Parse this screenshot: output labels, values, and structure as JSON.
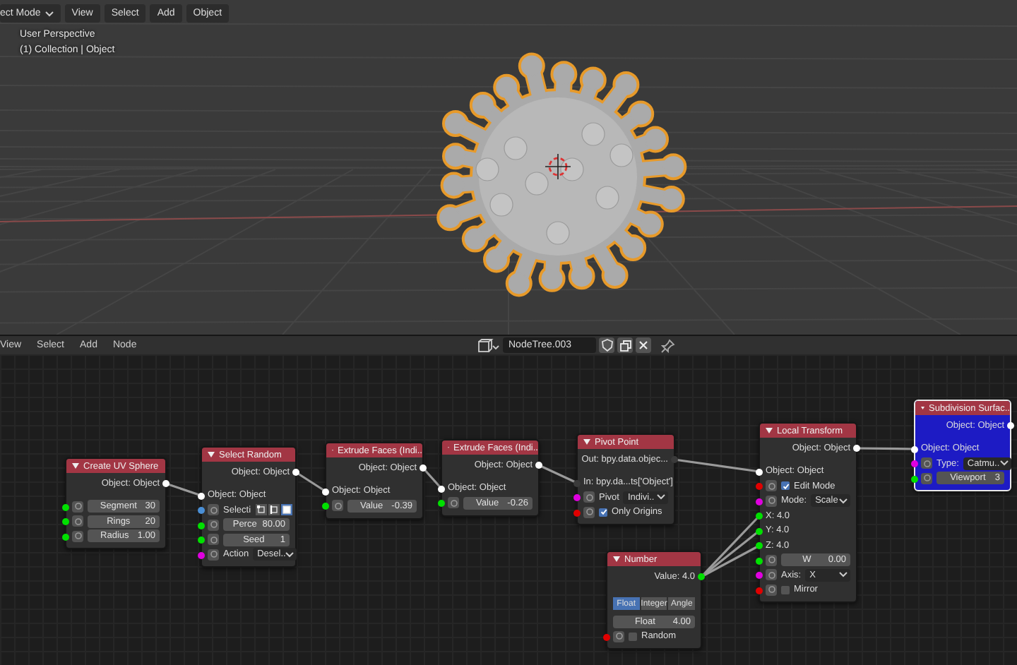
{
  "viewport": {
    "mode_menu": "ect Mode",
    "menus": [
      "View",
      "Select",
      "Add",
      "Object"
    ],
    "overlay": [
      "User Perspective",
      "(1) Collection | Object"
    ]
  },
  "node_editor": {
    "menus": [
      "View",
      "Select",
      "Add",
      "Node"
    ],
    "tree_name": "NodeTree.003",
    "nodes": [
      {
        "title": "Create UV Sphere",
        "selected": false,
        "rows": [
          {
            "kind": "output",
            "label": "Object: Object",
            "color": "#ffffff"
          },
          {
            "kind": "field",
            "label": "Segment",
            "value": "30",
            "color": "#00e000"
          },
          {
            "kind": "field",
            "label": "Rings",
            "value": "20",
            "color": "#00e000"
          },
          {
            "kind": "field",
            "label": "Radius",
            "value": "1.00",
            "color": "#00e000"
          }
        ]
      },
      {
        "title": "Select Random",
        "selected": false,
        "rows": [
          {
            "kind": "output",
            "label": "Object: Object",
            "color": "#ffffff"
          },
          {
            "kind": "input",
            "label": "Object: Object",
            "color": "#ffffff"
          },
          {
            "kind": "icons",
            "label": "Selecti",
            "color": "#4a8fd6",
            "options": [
              {
                "selected": false
              },
              {
                "selected": false
              },
              {
                "selected": true
              }
            ]
          },
          {
            "kind": "field",
            "label": "Perce",
            "value": "80.00",
            "color": "#00e000"
          },
          {
            "kind": "field",
            "label": "Seed",
            "value": "1",
            "color": "#00e000"
          },
          {
            "kind": "dropdown",
            "label": "Action",
            "value": "Desel..",
            "color": "#e000e0"
          }
        ]
      },
      {
        "title": "Extrude Faces (Indi..",
        "selected": false,
        "rows": [
          {
            "kind": "output",
            "label": "Object: Object",
            "color": "#ffffff"
          },
          {
            "kind": "input",
            "label": "Object: Object",
            "color": "#ffffff"
          },
          {
            "kind": "field",
            "label": "Value",
            "value": "-0.39",
            "color": "#00e000"
          }
        ]
      },
      {
        "title": "Extrude Faces (Indi..",
        "selected": false,
        "rows": [
          {
            "kind": "output",
            "label": "Object: Object",
            "color": "#ffffff"
          },
          {
            "kind": "input",
            "label": "Object: Object",
            "color": "#ffffff"
          },
          {
            "kind": "field",
            "label": "Value",
            "value": "-0.26",
            "color": "#00e000"
          }
        ]
      },
      {
        "title": "Pivot Point",
        "selected": false,
        "rows": [
          {
            "kind": "output",
            "label": "Out: bpy.data.objec...",
            "color": "#3a3a3a"
          },
          {
            "kind": "input",
            "label": "In: bpy.da...ts['Object']",
            "color": "#3a3a3a"
          },
          {
            "kind": "dropdown",
            "label": "Pivot",
            "value": "Indivi..",
            "color": "#e000e0"
          },
          {
            "kind": "checkbox",
            "label": "Only Origins",
            "checked": true,
            "color": "#e00000"
          }
        ]
      },
      {
        "title": "Local Transform",
        "selected": false,
        "rows": [
          {
            "kind": "output",
            "label": "Object: Object",
            "color": "#ffffff"
          },
          {
            "kind": "input",
            "label": "Object: Object",
            "color": "#ffffff"
          },
          {
            "kind": "checkbox",
            "label": "Edit Mode",
            "checked": true,
            "color": "#e00000"
          },
          {
            "kind": "dropdown",
            "label": "Mode:",
            "value": "Scale",
            "color": "#e000e0"
          },
          {
            "kind": "input",
            "label": "X: 4.0",
            "color": "#00e000"
          },
          {
            "kind": "input",
            "label": "Y: 4.0",
            "color": "#00e000"
          },
          {
            "kind": "input",
            "label": "Z: 4.0",
            "color": "#00e000"
          },
          {
            "kind": "field",
            "label": "W",
            "value": "0.00",
            "color": "#00e000"
          },
          {
            "kind": "dropdown",
            "label": "Axis:",
            "value": "X",
            "color": "#e000e0"
          },
          {
            "kind": "checkbox",
            "label": "Mirror",
            "checked": false,
            "color": "#e00000"
          }
        ]
      },
      {
        "title": "Subdivision Surfac..",
        "selected": true,
        "rows": [
          {
            "kind": "output",
            "label": "Object: Object",
            "color": "#ffffff"
          },
          {
            "kind": "input",
            "label": "Object: Object",
            "color": "#ffffff"
          },
          {
            "kind": "dropdown",
            "label": "Type:",
            "value": "Catmu..",
            "color": "#e000e0"
          },
          {
            "kind": "field",
            "label": "Viewport",
            "value": "3",
            "color": "#00e000"
          }
        ]
      },
      {
        "title": "Number",
        "selected": false,
        "rows": [
          {
            "kind": "output",
            "label": "Value: 4.0",
            "color": "#00e000"
          },
          {
            "kind": "toggles",
            "options": [
              {
                "label": "Float",
                "selected": true
              },
              {
                "label": "Integer",
                "selected": false
              },
              {
                "label": "Angle",
                "selected": false
              }
            ]
          },
          {
            "kind": "field",
            "label": "Float",
            "value": "4.00"
          },
          {
            "kind": "checkbox",
            "label": "Random",
            "checked": false,
            "color": "#e00000"
          }
        ]
      }
    ]
  }
}
